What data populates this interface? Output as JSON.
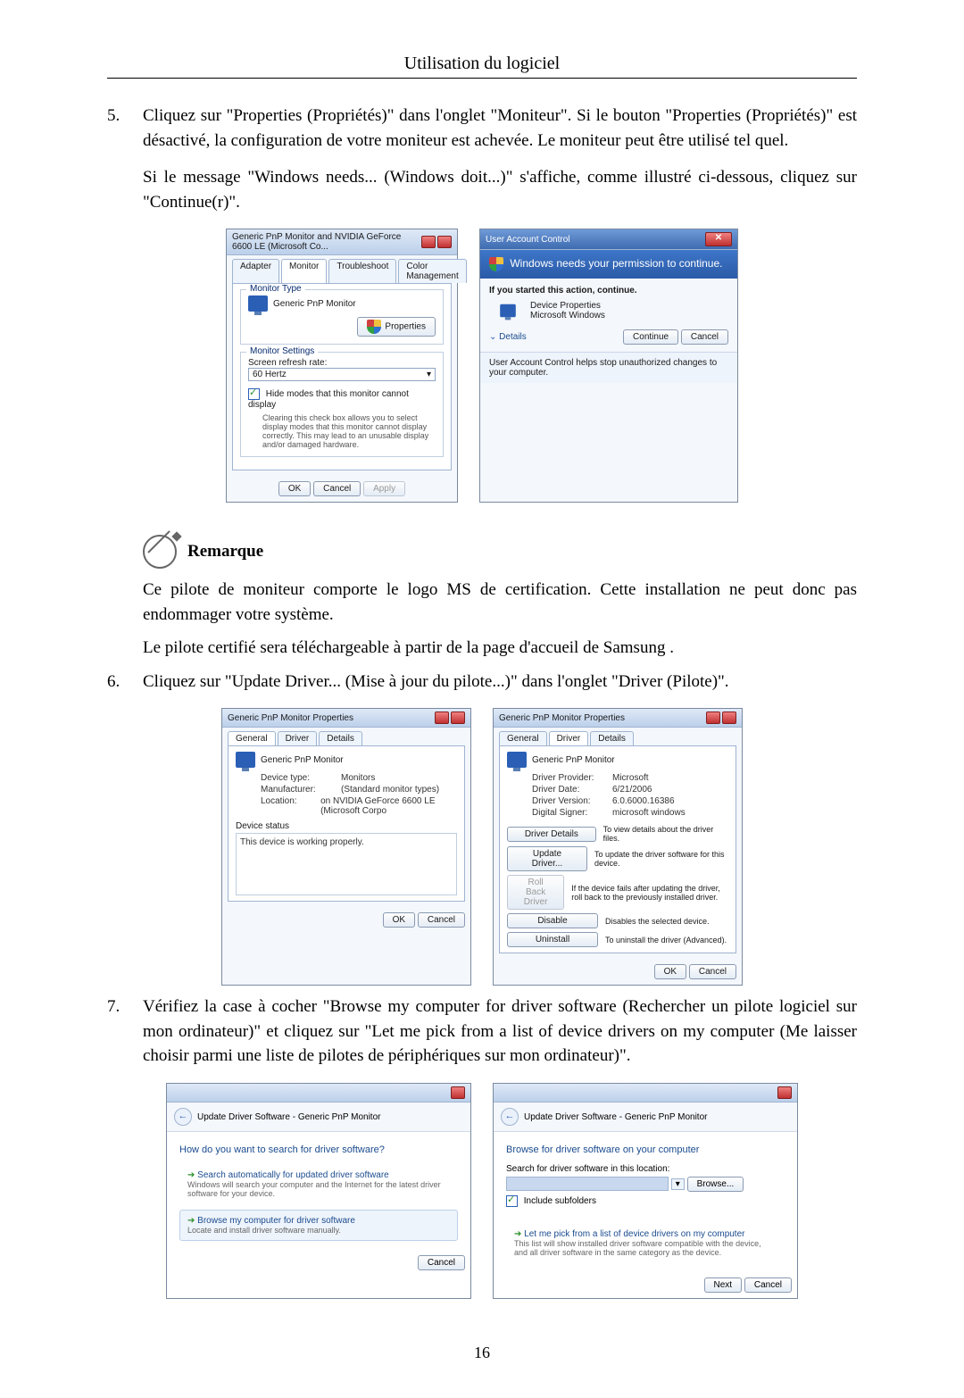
{
  "header": {
    "title": "Utilisation du logiciel"
  },
  "step5": {
    "num": "5.",
    "text": "Cliquez sur \"Properties (Propriétés)\" dans l'onglet \"Moniteur\". Si le bouton \"Properties (Propriétés)\" est désactivé, la configuration de votre moniteur est achevée. Le moniteur peut être utilisé tel quel.",
    "text2": "Si le message \"Windows needs... (Windows doit...)\" s'affiche, comme illustré ci-dessous, cliquez sur \"Continue(r)\"."
  },
  "dlg_monitor": {
    "title": "Generic PnP Monitor and NVIDIA GeForce 6600 LE (Microsoft Co...",
    "tabs": [
      "Adapter",
      "Monitor",
      "Troubleshoot",
      "Color Management"
    ],
    "group1": "Monitor Type",
    "device": "Generic PnP Monitor",
    "properties_btn": "Properties",
    "group2": "Monitor Settings",
    "refresh_label": "Screen refresh rate:",
    "refresh_value": "60 Hertz",
    "hide_label": "Hide modes that this monitor cannot display",
    "hide_desc": "Clearing this check box allows you to select display modes that this monitor cannot display correctly. This may lead to an unusable display and/or damaged hardware.",
    "ok": "OK",
    "cancel": "Cancel",
    "apply": "Apply"
  },
  "dlg_uac": {
    "title": "User Account Control",
    "bar": "Windows needs your permission to continue.",
    "started": "If you started this action, continue.",
    "dev": "Device Properties",
    "pub": "Microsoft Windows",
    "details": "Details",
    "continue": "Continue",
    "cancel": "Cancel",
    "footer": "User Account Control helps stop unauthorized changes to your computer."
  },
  "note": {
    "title": "Remarque",
    "p1": "Ce pilote de moniteur comporte le logo MS de certification. Cette installation ne peut donc pas endommager votre système.",
    "p2": "Le pilote certifié sera téléchargeable à partir de la page d'accueil de Samsung ."
  },
  "step6": {
    "num": "6.",
    "text": "Cliquez sur \"Update Driver... (Mise à jour du pilote...)\" dans l'onglet \"Driver (Pilote)\"."
  },
  "dlg_props_general": {
    "title": "Generic PnP Monitor Properties",
    "tabs": [
      "General",
      "Driver",
      "Details"
    ],
    "device": "Generic PnP Monitor",
    "dtlabel": "Device type:",
    "dtval": "Monitors",
    "mflabel": "Manufacturer:",
    "mfval": "(Standard monitor types)",
    "loclabel": "Location:",
    "locval": "on NVIDIA GeForce 6600 LE (Microsoft Corpo",
    "status_label": "Device status",
    "status_text": "This device is working properly.",
    "ok": "OK",
    "cancel": "Cancel"
  },
  "dlg_props_driver": {
    "title": "Generic PnP Monitor Properties",
    "tabs": [
      "General",
      "Driver",
      "Details"
    ],
    "device": "Generic PnP Monitor",
    "provlabel": "Driver Provider:",
    "provval": "Microsoft",
    "datelabel": "Driver Date:",
    "dateval": "6/21/2006",
    "verlabel": "Driver Version:",
    "verval": "6.0.6000.16386",
    "signlabel": "Digital Signer:",
    "signval": "microsoft windows",
    "details_btn": "Driver Details",
    "details_desc": "To view details about the driver files.",
    "update_btn": "Update Driver...",
    "update_desc": "To update the driver software for this device.",
    "rollback_btn": "Roll Back Driver",
    "rollback_desc": "If the device fails after updating the driver, roll back to the previously installed driver.",
    "disable_btn": "Disable",
    "disable_desc": "Disables the selected device.",
    "uninstall_btn": "Uninstall",
    "uninstall_desc": "To uninstall the driver (Advanced).",
    "ok": "OK",
    "cancel": "Cancel"
  },
  "step7": {
    "num": "7.",
    "text": "Vérifiez la case à cocher \"Browse my computer for driver software (Rechercher un pilote logiciel sur mon ordinateur)\" et cliquez sur \"Let me pick from a list of device drivers on my computer (Me laisser choisir parmi une liste de pilotes de périphériques sur mon ordinateur)\"."
  },
  "wiz1": {
    "crumb": "Update Driver Software - Generic PnP Monitor",
    "heading": "How do you want to search for driver software?",
    "opt1t": "Search automatically for updated driver software",
    "opt1d": "Windows will search your computer and the Internet for the latest driver software for your device.",
    "opt2t": "Browse my computer for driver software",
    "opt2d": "Locate and install driver software manually.",
    "cancel": "Cancel"
  },
  "wiz2": {
    "crumb": "Update Driver Software - Generic PnP Monitor",
    "heading": "Browse for driver software on your computer",
    "searchlabel": "Search for driver software in this location:",
    "browse": "Browse...",
    "include": "Include subfolders",
    "pick_t": "Let me pick from a list of device drivers on my computer",
    "pick_d": "This list will show installed driver software compatible with the device, and all driver software in the same category as the device.",
    "next": "Next",
    "cancel": "Cancel"
  },
  "page_number": "16"
}
